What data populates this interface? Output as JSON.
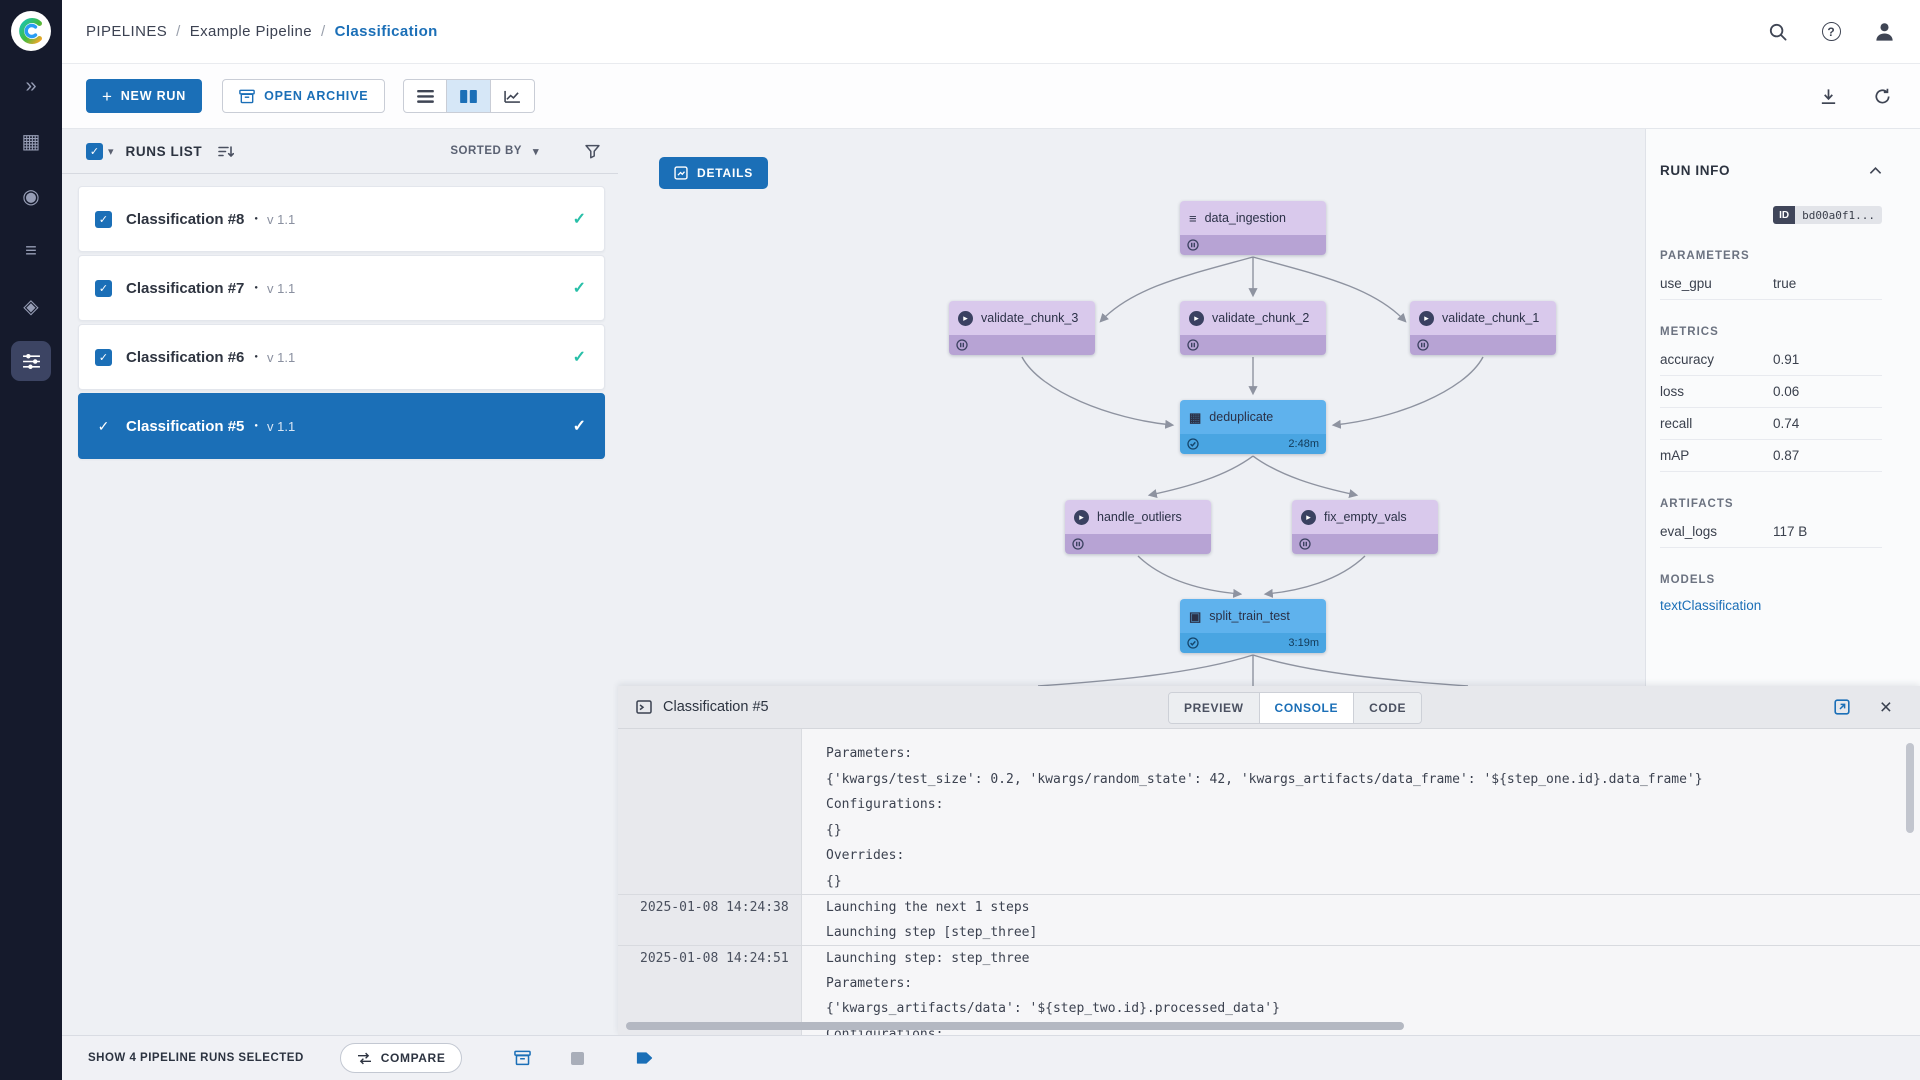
{
  "icons": {
    "check": "✓",
    "caret_down": "▾",
    "dot": "●",
    "close": "×",
    "plus": "+",
    "question": "?",
    "apps": "»",
    "projects": "▦",
    "workers": "◉",
    "datasets": "≡",
    "models": "◈",
    "node_play": "▸",
    "node_grid": "▦",
    "node_layers": "≡",
    "node_split": "▣"
  },
  "breadcrumb": {
    "root": "PIPELINES",
    "sep": "/",
    "project": "Example Pipeline",
    "page": "Classification"
  },
  "toolbar": {
    "new_run": "NEW RUN",
    "open_archive": "OPEN ARCHIVE"
  },
  "runs_list": {
    "title": "RUNS LIST",
    "sorted_by": "SORTED BY",
    "items": [
      {
        "name": "Classification #8",
        "version": "v 1.1",
        "checked": true,
        "selected": false
      },
      {
        "name": "Classification #7",
        "version": "v 1.1",
        "checked": true,
        "selected": false
      },
      {
        "name": "Classification #6",
        "version": "v 1.1",
        "checked": true,
        "selected": false
      },
      {
        "name": "Classification #5",
        "version": "v 1.1",
        "checked": true,
        "selected": true
      }
    ]
  },
  "canvas": {
    "details_label": "DETAILS",
    "nodes": [
      {
        "label": "data_ingestion",
        "status": "pending"
      },
      {
        "label": "validate_chunk_3",
        "status": "pending"
      },
      {
        "label": "validate_chunk_2",
        "status": "pending"
      },
      {
        "label": "validate_chunk_1",
        "status": "pending"
      },
      {
        "label": "deduplicate",
        "status": "completed",
        "time": "2:48m"
      },
      {
        "label": "handle_outliers",
        "status": "pending"
      },
      {
        "label": "fix_empty_vals",
        "status": "pending"
      },
      {
        "label": "split_train_test",
        "status": "completed",
        "time": "3:19m"
      }
    ]
  },
  "run_info": {
    "title": "RUN INFO",
    "id_label": "ID",
    "id_value": "bd00a0f1...",
    "parameters_title": "PARAMETERS",
    "parameters": [
      {
        "key": "use_gpu",
        "value": "true"
      }
    ],
    "metrics_title": "METRICS",
    "metrics": [
      {
        "key": "accuracy",
        "value": "0.91"
      },
      {
        "key": "loss",
        "value": "0.06"
      },
      {
        "key": "recall",
        "value": "0.74"
      },
      {
        "key": "mAP",
        "value": "0.87"
      }
    ],
    "artifacts_title": "ARTIFACTS",
    "artifacts": [
      {
        "key": "eval_logs",
        "value": "117 B"
      }
    ],
    "models_title": "MODELS",
    "model_link": "textClassification"
  },
  "console": {
    "title": "Classification #5",
    "tabs": [
      {
        "label": "PREVIEW"
      },
      {
        "label": "CONSOLE"
      },
      {
        "label": "CODE"
      }
    ],
    "active_tab": "CONSOLE",
    "rows": [
      {
        "ts": "",
        "text": "Parameters:"
      },
      {
        "ts": "",
        "text": "{'kwargs/test_size': 0.2, 'kwargs/random_state': 42, 'kwargs_artifacts/data_frame': '${step_one.id}.data_frame'}"
      },
      {
        "ts": "",
        "text": "Configurations:"
      },
      {
        "ts": "",
        "text": "{}"
      },
      {
        "ts": "",
        "text": "Overrides:"
      },
      {
        "ts": "",
        "text": "{}"
      },
      {
        "ts": "2025-01-08 14:24:38",
        "text": "Launching the next 1 steps"
      },
      {
        "ts": "",
        "text": "Launching step [step_three]"
      },
      {
        "ts": "2025-01-08 14:24:51",
        "text": "Launching step: step_three"
      },
      {
        "ts": "",
        "text": "Parameters:"
      },
      {
        "ts": "",
        "text": "{'kwargs_artifacts/data': '${step_two.id}.processed_data'}"
      },
      {
        "ts": "",
        "text": "Configurations:"
      }
    ]
  },
  "footer": {
    "selection_text": "SHOW 4 PIPELINE RUNS SELECTED",
    "compare": "COMPARE"
  }
}
